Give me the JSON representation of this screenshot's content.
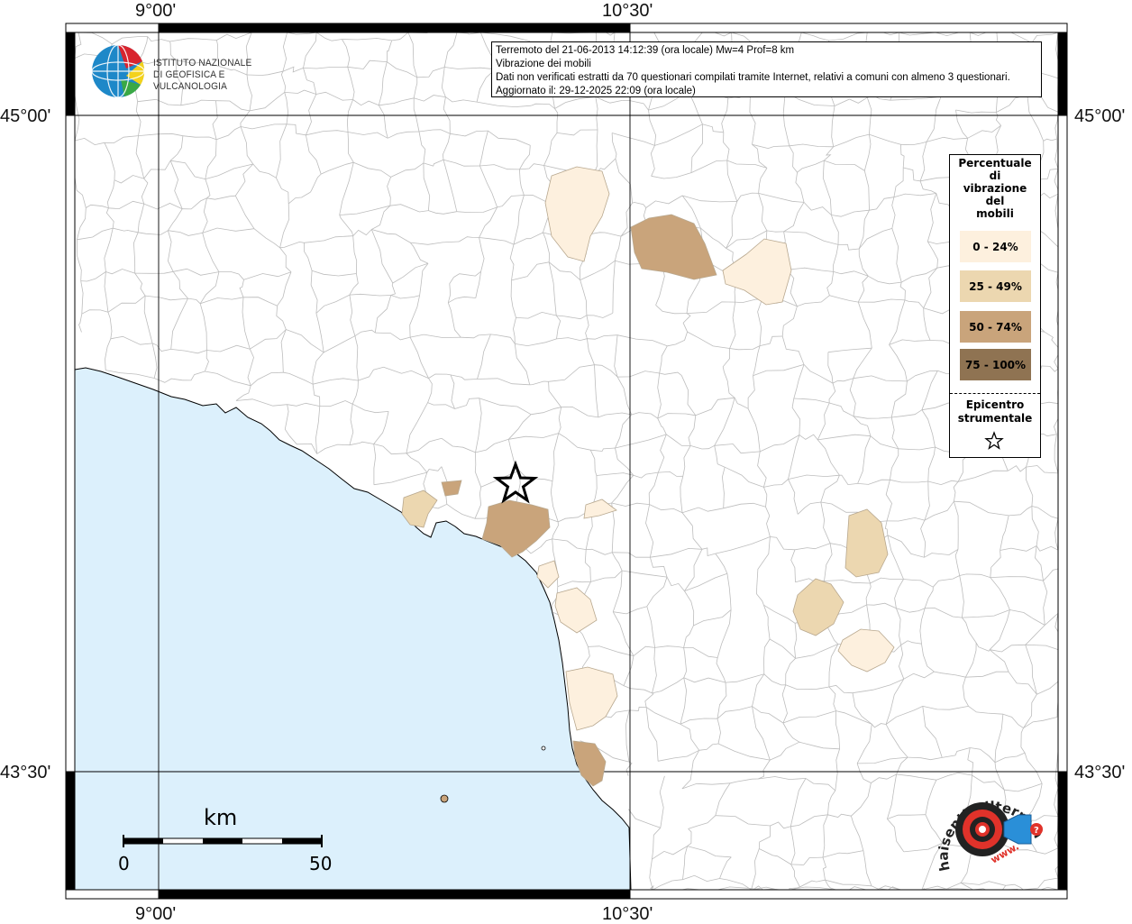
{
  "info": {
    "line1": "Terremoto del 21-06-2013 14:12:39 (ora locale) Mw=4 Prof=8 km",
    "line2": "Vibrazione dei mobili",
    "line3": "Dati non verificati estratti da 70 questionari compilati tramite Internet, relativi a comuni con almeno 3 questionari.",
    "line4": "Aggiornato il: 29-12-2025 22:09 (ora locale)"
  },
  "coords": {
    "top_left": "9°00'",
    "top_right": "10°30'",
    "bottom_left": "9°00'",
    "bottom_right": "10°30'",
    "left_upper": "45°00'",
    "left_lower": "43°30'",
    "right_upper": "45°00'",
    "right_lower": "43°30'"
  },
  "logo_ingv": {
    "line1": "ISTITUTO NAZIONALE",
    "line2": "DI GEOFISICA E VULCANOLOGIA"
  },
  "legend": {
    "title": [
      "Percentuale",
      "di",
      "vibrazione",
      "del",
      "mobili"
    ],
    "items": [
      {
        "label": "0 - 24%",
        "color": "#fdf0de"
      },
      {
        "label": "25 - 49%",
        "color": "#ecd7b0"
      },
      {
        "label": "50 - 74%",
        "color": "#c9a47b"
      },
      {
        "label": "75 - 100%",
        "color": "#8f7352"
      }
    ],
    "epicenter": [
      "Epicentro",
      "strumentale"
    ],
    "epicenter_icon": "star-outline-icon"
  },
  "scale": {
    "title": "km",
    "min": "0",
    "max": "50"
  },
  "logo_hst": {
    "text_ring": "haisentitoilterremoto.it",
    "text_www": "www."
  },
  "colors": {
    "sea": "#dcf0fc",
    "land": "#ffffff",
    "boundary": "#bdbdbd",
    "class1": "#fdf0de",
    "class2": "#ecd7b0",
    "class3": "#c9a47b",
    "class4": "#8f7352"
  }
}
